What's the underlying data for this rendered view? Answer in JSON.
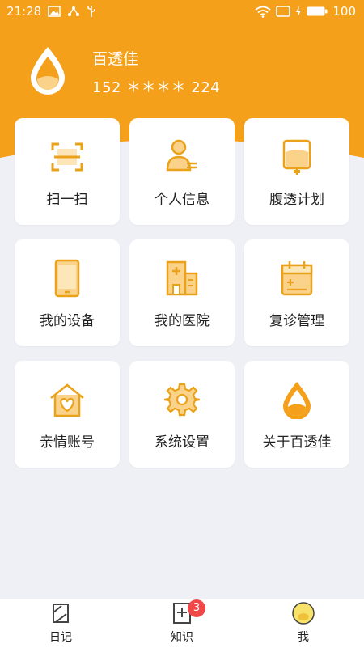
{
  "status_bar": {
    "time": "21:28",
    "battery": "100"
  },
  "theme": {
    "accent": "#f5a01a",
    "accent_dark": "#e08d0c",
    "background": "#eef0f6"
  },
  "profile": {
    "name": "百透佳",
    "phone": "152 ＊＊＊＊ 224"
  },
  "menu": [
    {
      "label": "扫一扫",
      "icon": "scan-icon"
    },
    {
      "label": "个人信息",
      "icon": "person-info-icon"
    },
    {
      "label": "腹透计划",
      "icon": "dialysis-bag-icon"
    },
    {
      "label": "我的设备",
      "icon": "phone-device-icon"
    },
    {
      "label": "我的医院",
      "icon": "hospital-icon"
    },
    {
      "label": "复诊管理",
      "icon": "calendar-icon"
    },
    {
      "label": "亲情账号",
      "icon": "family-home-icon"
    },
    {
      "label": "系统设置",
      "icon": "gear-icon"
    },
    {
      "label": "关于百透佳",
      "icon": "drop-logo-icon"
    }
  ],
  "bottom_nav": [
    {
      "label": "日记",
      "icon": "diary-icon"
    },
    {
      "label": "知识",
      "icon": "knowledge-icon",
      "badge": "3"
    },
    {
      "label": "我",
      "icon": "me-avatar-icon"
    }
  ]
}
